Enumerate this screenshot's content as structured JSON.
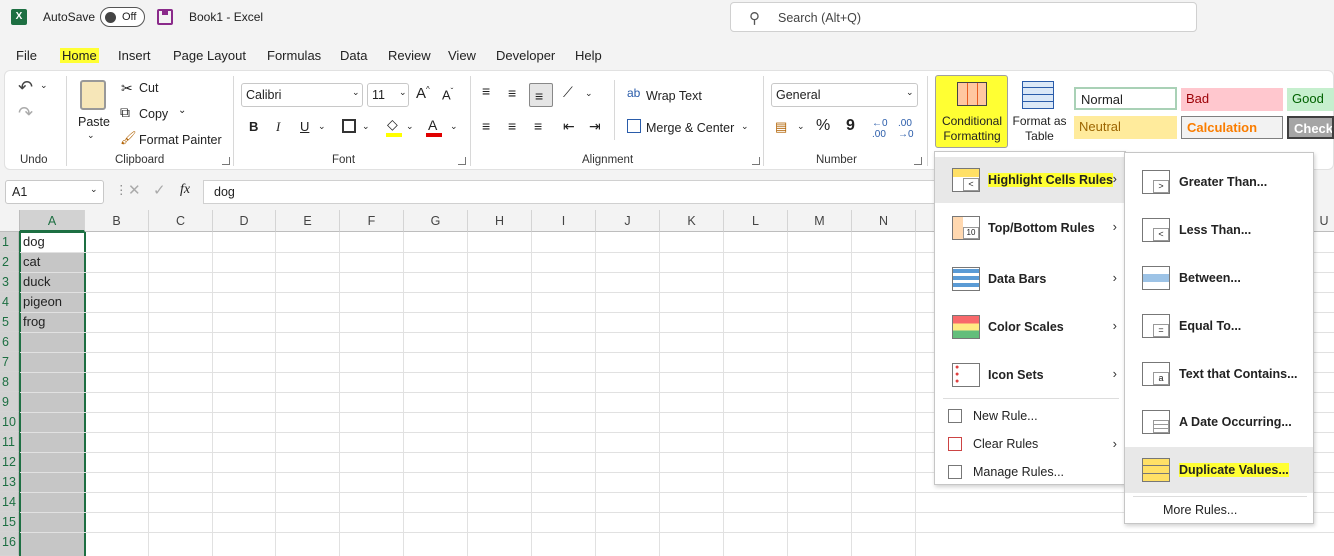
{
  "titlebar": {
    "logo": "X",
    "autosave_label": "AutoSave",
    "autosave_state": "Off",
    "doc_title": "Book1  -  Excel",
    "search_placeholder": "Search (Alt+Q)"
  },
  "menu": [
    "File",
    "Home",
    "Insert",
    "Page Layout",
    "Formulas",
    "Data",
    "Review",
    "View",
    "Developer",
    "Help"
  ],
  "ribbon": {
    "undo_group": "Undo",
    "clipboard": {
      "paste": "Paste",
      "cut": "Cut",
      "copy": "Copy",
      "format_painter": "Format Painter",
      "group": "Clipboard"
    },
    "font": {
      "name": "Calibri",
      "size": "11",
      "group": "Font"
    },
    "alignment": {
      "wrap_text": "Wrap Text",
      "merge_center": "Merge & Center",
      "group": "Alignment"
    },
    "number": {
      "format": "General",
      "group": "Number"
    },
    "conditional_formatting": "Conditional Formatting",
    "format_as_table": "Format as Table",
    "styles": {
      "normal": "Normal",
      "bad": "Bad",
      "good": "Good",
      "neutral": "Neutral",
      "calculation": "Calculation",
      "check": "Check C"
    }
  },
  "formula_bar": {
    "name_box": "A1",
    "fx": "fx",
    "value": "dog"
  },
  "columns": [
    "A",
    "B",
    "C",
    "D",
    "E",
    "F",
    "G",
    "H",
    "I",
    "J",
    "K",
    "L",
    "M",
    "N",
    "U"
  ],
  "rows": [
    "1",
    "2",
    "3",
    "4",
    "5",
    "6",
    "7",
    "8",
    "9",
    "10",
    "11",
    "12",
    "13",
    "14",
    "15",
    "16"
  ],
  "cells": [
    "dog",
    "cat",
    "duck",
    "pigeon",
    "frog"
  ],
  "cf_menu": {
    "items": [
      "Highlight Cells Rules",
      "Top/Bottom Rules",
      "Data Bars",
      "Color Scales",
      "Icon Sets"
    ],
    "small_items": [
      "New Rule...",
      "Clear Rules",
      "Manage Rules..."
    ]
  },
  "submenu": {
    "items": [
      "Greater Than...",
      "Less Than...",
      "Between...",
      "Equal To...",
      "Text that Contains...",
      "A Date Occurring...",
      "Duplicate Values..."
    ],
    "more": "More Rules..."
  },
  "colors": {
    "accent": "#1d6f42",
    "highlight": "#ffff33",
    "selection": "#c6c6c6"
  }
}
